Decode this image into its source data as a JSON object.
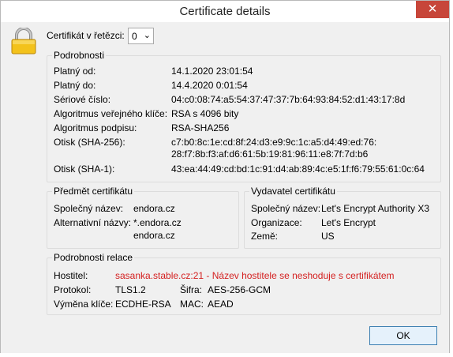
{
  "window": {
    "title": "Certificate details",
    "close_glyph": "✕",
    "close_color": "#c7463a"
  },
  "chain": {
    "label": "Certifikát v řetězci:",
    "selected": "0"
  },
  "details": {
    "legend": "Podrobnosti",
    "rows": [
      {
        "label": "Platný od:",
        "value": "14.1.2020 23:01:54"
      },
      {
        "label": "Platný do:",
        "value": "14.4.2020 0:01:54"
      },
      {
        "label": "Sériové číslo:",
        "value": "04:c0:08:74:a5:54:37:47:37:7b:64:93:84:52:d1:43:17:8d"
      },
      {
        "label": "Algoritmus veřejného klíče:",
        "value": "RSA s 4096 bity"
      },
      {
        "label": "Algoritmus podpisu:",
        "value": "RSA-SHA256"
      },
      {
        "label": "Otisk (SHA-256):",
        "value": "c7:b0:8c:1e:cd:8f:24:d3:e9:9c:1c:a5:d4:49:ed:76:",
        "value2": "28:f7:8b:f3:af:d6:61:5b:19:81:96:11:e8:7f:7d:b6"
      },
      {
        "label": "Otisk (SHA-1):",
        "value": "43:ea:44:49:cd:bd:1c:91:d4:ab:89:4c:e5:1f:f6:79:55:61:0c:64"
      }
    ]
  },
  "subject": {
    "legend": "Předmět certifikátu",
    "common_name_label": "Společný název:",
    "common_name": "endora.cz",
    "alt_names_label": "Alternativní názvy:",
    "alt_names": [
      "*.endora.cz",
      "endora.cz"
    ]
  },
  "issuer": {
    "legend": "Vydavatel certifikátu",
    "common_name_label": "Společný název:",
    "common_name": "Let's Encrypt Authority X3",
    "org_label": "Organizace:",
    "org": "Let's Encrypt",
    "country_label": "Země:",
    "country": "US"
  },
  "session": {
    "legend": "Podrobnosti relace",
    "host_label": "Hostitel:",
    "host_value": "sasanka.stable.cz:21 - Název hostitele se neshoduje s certifikátem",
    "protocol_label": "Protokol:",
    "protocol": "TLS1.2",
    "cipher_label": "Šifra:",
    "cipher": "AES-256-GCM",
    "kex_label": "Výměna klíče:",
    "kex": "ECDHE-RSA",
    "mac_label": "MAC:",
    "mac": "AEAD",
    "warning_color": "#d42020"
  },
  "footer": {
    "ok_label": "OK"
  },
  "icons": {
    "lock": "lock-icon",
    "dropdown": "chevron-down-icon"
  }
}
